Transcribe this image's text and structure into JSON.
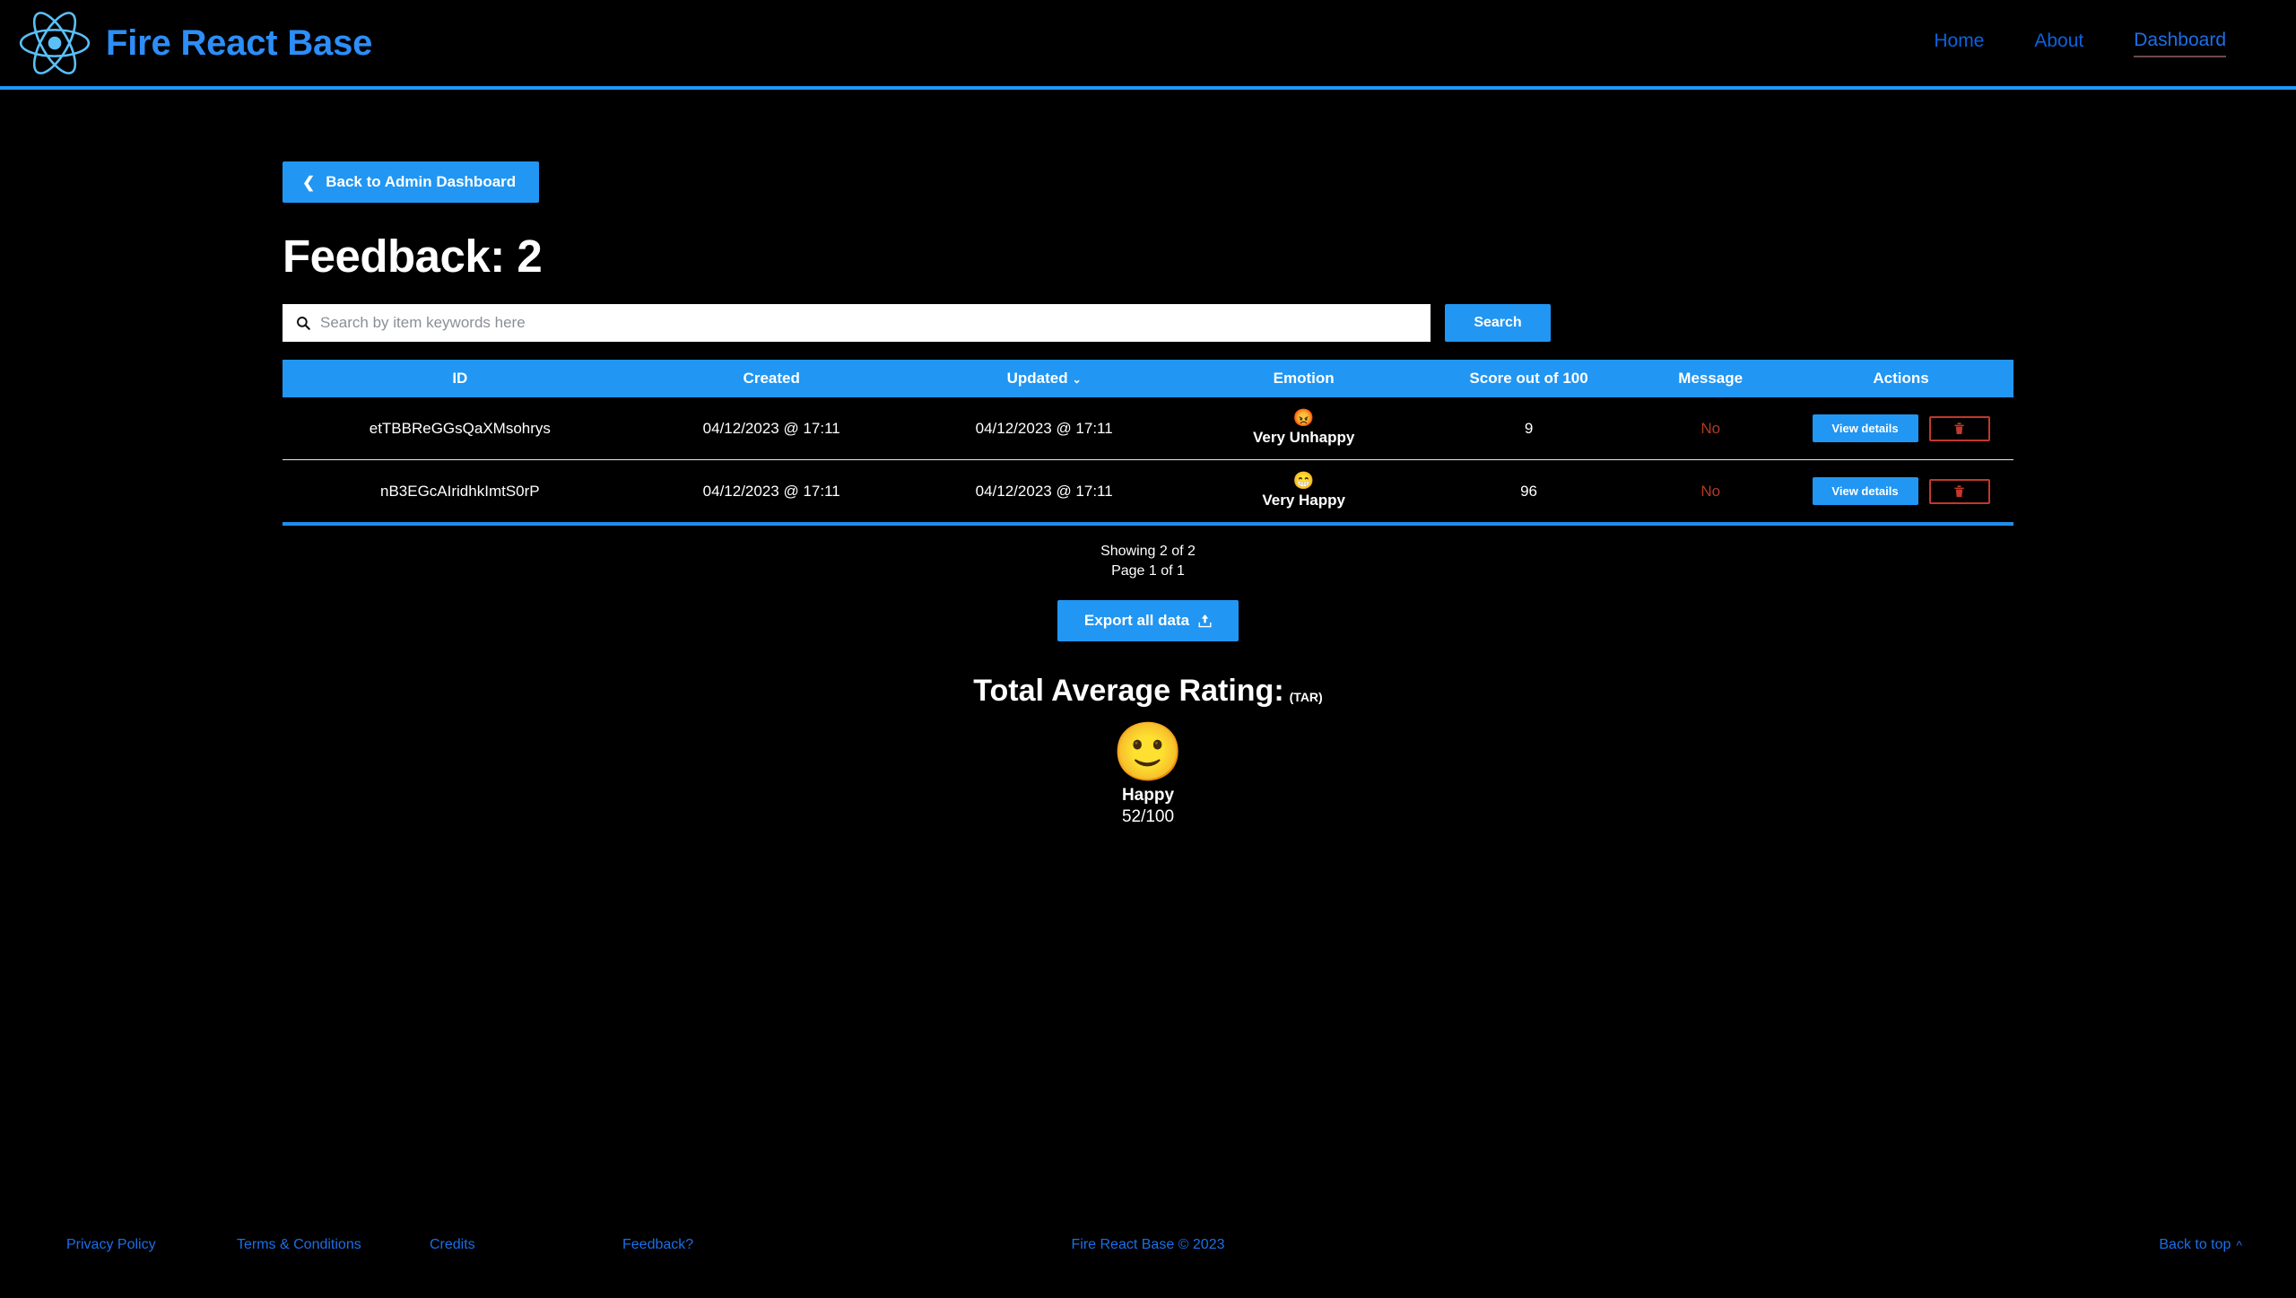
{
  "header": {
    "brand": "Fire React Base",
    "logo_icon": "react-atom-logo",
    "nav": [
      {
        "label": "Home",
        "active": false
      },
      {
        "label": "About",
        "active": false
      },
      {
        "label": "Dashboard",
        "active": true
      }
    ],
    "accent_color": "#2196f3",
    "brand_color": "#2c8ef8"
  },
  "main": {
    "back_button": {
      "label": "Back to Admin Dashboard",
      "icon": "chevron-left-icon"
    },
    "title": "Feedback: 2",
    "search": {
      "placeholder": "Search by item keywords here",
      "value": "",
      "icon": "search-icon",
      "button_label": "Search"
    },
    "table": {
      "columns": [
        "ID",
        "Created",
        "Updated",
        "Emotion",
        "Score out of 100",
        "Message",
        "Actions"
      ],
      "sort_column": "Updated",
      "sort_icon": "chevron-down-icon",
      "rows": [
        {
          "id": "etTBBReGGsQaXMsohrys",
          "created": "04/12/2023 @ 17:11",
          "updated": "04/12/2023 @ 17:11",
          "emotion_emoji": "😡",
          "emotion": "Very Unhappy",
          "score": "9",
          "message": "No",
          "view_label": "View details",
          "delete_icon": "trash-icon"
        },
        {
          "id": "nB3EGcAIridhkImtS0rP",
          "created": "04/12/2023 @ 17:11",
          "updated": "04/12/2023 @ 17:11",
          "emotion_emoji": "😁",
          "emotion": "Very Happy",
          "score": "96",
          "message": "No",
          "view_label": "View details",
          "delete_icon": "trash-icon"
        }
      ]
    },
    "pagination": {
      "showing": "Showing 2 of 2",
      "page": "Page 1 of 1"
    },
    "export": {
      "label": "Export all data",
      "icon": "upload-icon"
    },
    "total_average_rating": {
      "title": "Total Average Rating:",
      "abbreviation": "(TAR)",
      "emoji": "🙂",
      "label": "Happy",
      "score": "52/100"
    },
    "message_color": "#b33a1f",
    "delete_border_color": "#c0392b"
  },
  "footer": {
    "links": [
      "Privacy Policy",
      "Terms & Conditions",
      "Credits",
      "Feedback?"
    ],
    "copyright": "Fire React Base © 2023",
    "back_to_top": "Back to top",
    "back_to_top_icon": "chevron-up-icon"
  }
}
